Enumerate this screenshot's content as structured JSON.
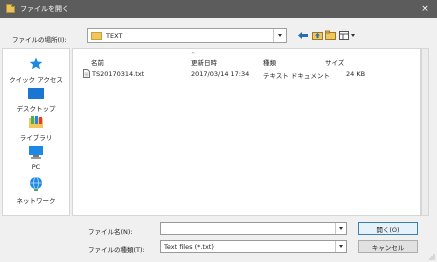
{
  "window": {
    "title": "ファイルを開く",
    "close_glyph": "×"
  },
  "toolbar": {
    "location_label": "ファイルの場所(I):",
    "location_value": "TEXT"
  },
  "sidebar": {
    "items": [
      {
        "label": "クイック アクセス",
        "icon": "star-icon"
      },
      {
        "label": "デスクトップ",
        "icon": "desktop-icon"
      },
      {
        "label": "ライブラリ",
        "icon": "library-icon"
      },
      {
        "label": "PC",
        "icon": "pc-icon"
      },
      {
        "label": "ネットワーク",
        "icon": "network-icon"
      }
    ]
  },
  "filelist": {
    "columns": [
      "名前",
      "更新日時",
      "種類",
      "サイズ"
    ],
    "rows": [
      {
        "name": "TS20170314.txt",
        "modified": "2017/03/14 17:34",
        "type": "テキスト ドキュメント",
        "size": "24 KB"
      }
    ]
  },
  "form": {
    "filename_label": "ファイル名(N):",
    "filename_value": "",
    "filetype_label": "ファイルの種類(T):",
    "filetype_value": "Text files (*.txt)"
  },
  "buttons": {
    "open": "開く(O)",
    "cancel": "キャンセル"
  },
  "colors": {
    "titlebar": "#5c5c5c",
    "accent": "#3c7fb1",
    "folder": "#f1c75b"
  }
}
